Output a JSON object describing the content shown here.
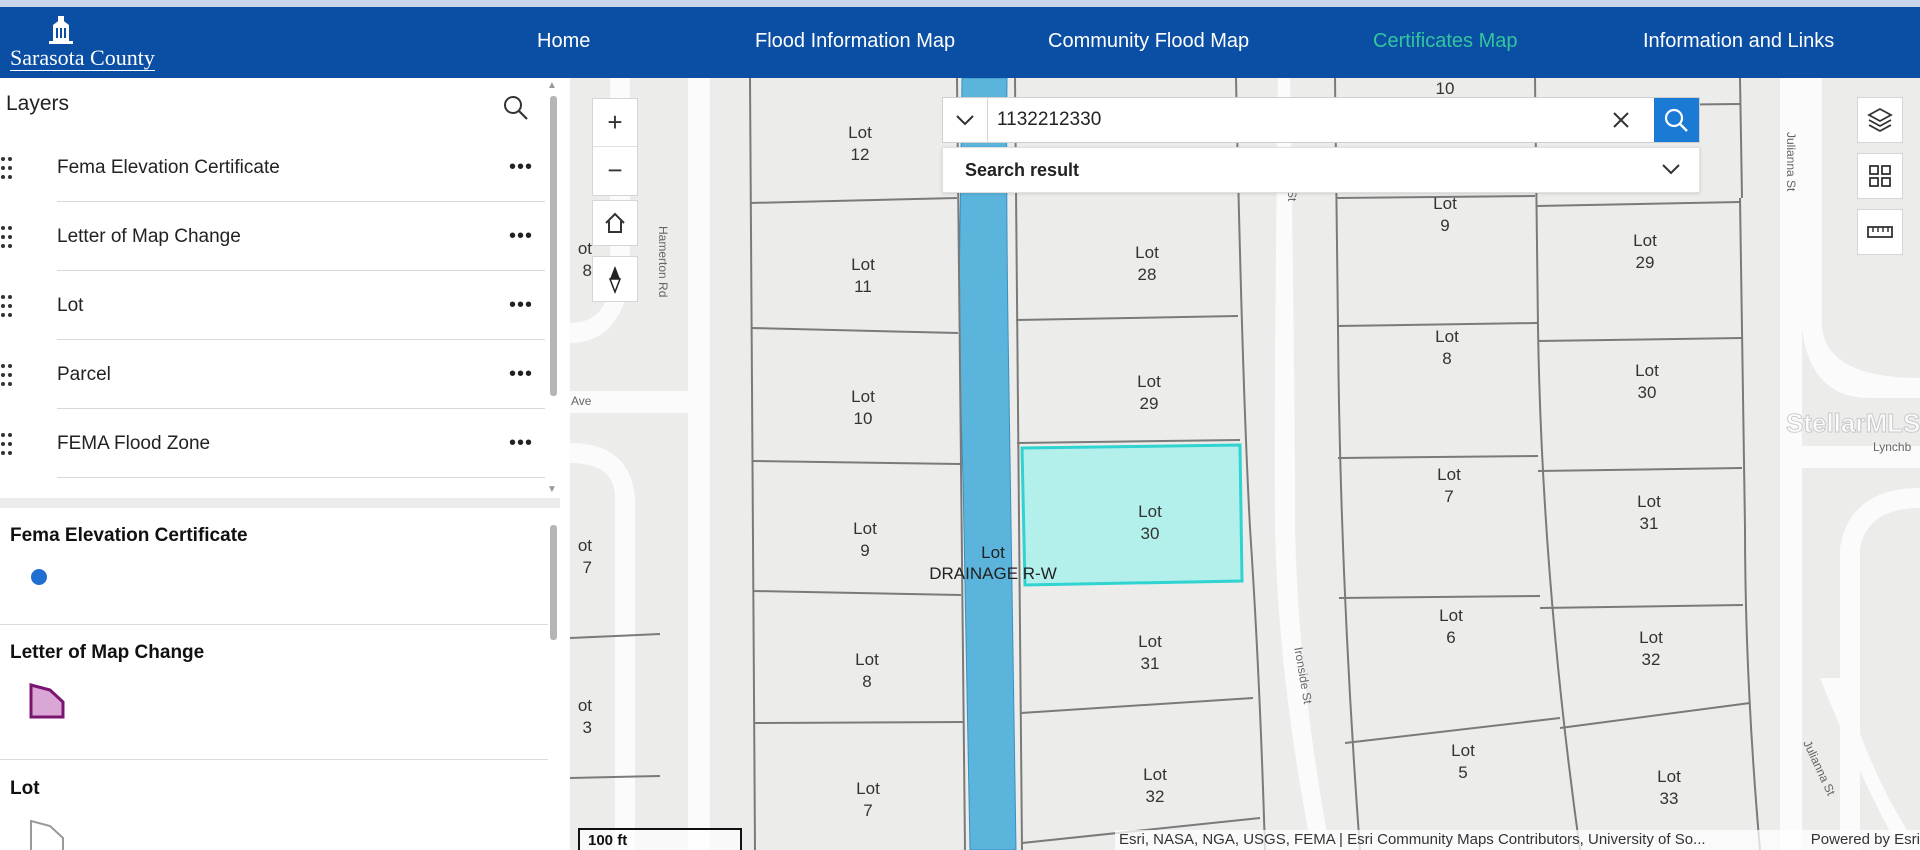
{
  "brand": {
    "name": "Sarasota County"
  },
  "nav": {
    "items": [
      {
        "label": "Home"
      },
      {
        "label": "Flood Information Map"
      },
      {
        "label": "Community Flood Map"
      },
      {
        "label": "Certificates Map"
      },
      {
        "label": "Information and Links"
      }
    ],
    "active_color": "#33c59d",
    "header_color": "#0a4fa3"
  },
  "layers_panel": {
    "title": "Layers",
    "search_icon": "search-icon",
    "items": [
      {
        "label": "Fema Elevation Certificate"
      },
      {
        "label": "Letter of Map Change"
      },
      {
        "label": "Lot"
      },
      {
        "label": "Parcel"
      },
      {
        "label": "FEMA Flood Zone"
      }
    ],
    "more_label": "•••"
  },
  "legend": {
    "items": [
      {
        "title": "Fema Elevation Certificate",
        "symbol": "blue-point",
        "color": "#1f6fd1"
      },
      {
        "title": "Letter of Map Change",
        "symbol": "purple-polygon",
        "color": "#d9a6d6"
      },
      {
        "title": "Lot",
        "symbol": "gray-outline-polygon"
      }
    ]
  },
  "search": {
    "value": "1132212330",
    "result_label": "Search result"
  },
  "map": {
    "lots": [
      {
        "text": "Lot\n12"
      },
      {
        "text": "Lot\n11"
      },
      {
        "text": "Lot\n10"
      },
      {
        "text": "Lot\n9"
      },
      {
        "text": "Lot\n8"
      },
      {
        "text": "Lot\n7"
      },
      {
        "text": "Lot\n28"
      },
      {
        "text": "Lot\n29"
      },
      {
        "text": "Lot\n30"
      },
      {
        "text": "Lot\n31"
      },
      {
        "text": "Lot\n32"
      },
      {
        "text": "10"
      },
      {
        "text": "Lot\n9"
      },
      {
        "text": "Lot\n8"
      },
      {
        "text": "Lot\n7"
      },
      {
        "text": "Lot\n6"
      },
      {
        "text": "Lot\n5"
      },
      {
        "text": "Lot\n29"
      },
      {
        "text": "Lot\n30"
      },
      {
        "text": "Lot\n31"
      },
      {
        "text": "Lot\n32"
      },
      {
        "text": "Lot\n33"
      },
      {
        "text": "ot\n8"
      },
      {
        "text": "ot\n7"
      },
      {
        "text": "ot\n3"
      }
    ],
    "drainage_label": "Lot\nDRAINAGE R-W",
    "streets": {
      "hamerton": "Hamerton Rd",
      "ave": "Ave",
      "ironside": "Ironside St",
      "julianna_top": "Julianna St",
      "julianna_bottom": "Julianna St",
      "lynch": "Lynchb",
      "st_fragment": "St"
    },
    "selected_lot": "Lot 30",
    "selected_color": "#b3f0ec",
    "drainage_color": "#5bb4dc",
    "watermark": "StellarMLS",
    "scale": "100 ft",
    "attribution": "Esri, NASA, NGA, USGS, FEMA | Esri Community Maps Contributors, University of So...",
    "powered_by": "Powered by Esri",
    "controls": {
      "zoom_in": "+",
      "zoom_out": "−"
    }
  }
}
